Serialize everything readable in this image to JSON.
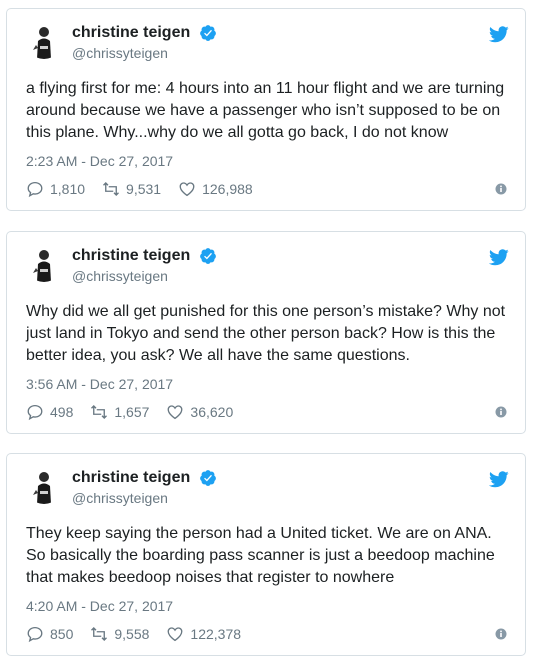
{
  "colors": {
    "twitter_blue": "#1da1f2",
    "secondary_text": "#697882",
    "primary_text": "#1c2022",
    "border": "#d7dfe4"
  },
  "tweets": [
    {
      "display_name": "christine teigen",
      "handle": "@chrissyteigen",
      "text": "a flying first for me: 4 hours into an 11 hour flight and we are turning\naround because we have a passenger who isn’t supposed to be on\nthis plane. Why...why do we all gotta go back, I do not know",
      "timestamp": "2:23 AM - Dec 27, 2017",
      "replies": "1,810",
      "retweets": "9,531",
      "likes": "126,988"
    },
    {
      "display_name": "christine teigen",
      "handle": "@chrissyteigen",
      "text": "Why did we all get punished for this one person’s mistake? Why not\njust land in Tokyo and send the other person back? How is this the\nbetter idea, you ask? We all have the same questions.",
      "timestamp": "3:56 AM - Dec 27, 2017",
      "replies": "498",
      "retweets": "1,657",
      "likes": "36,620"
    },
    {
      "display_name": "christine teigen",
      "handle": "@chrissyteigen",
      "text": "They keep saying the person had a United ticket. We are on ANA.\nSo basically the boarding pass scanner is just a beedoop machine\nthat makes beedoop noises that register to nowhere",
      "timestamp": "4:20 AM - Dec 27, 2017",
      "replies": "850",
      "retweets": "9,558",
      "likes": "122,378"
    }
  ]
}
